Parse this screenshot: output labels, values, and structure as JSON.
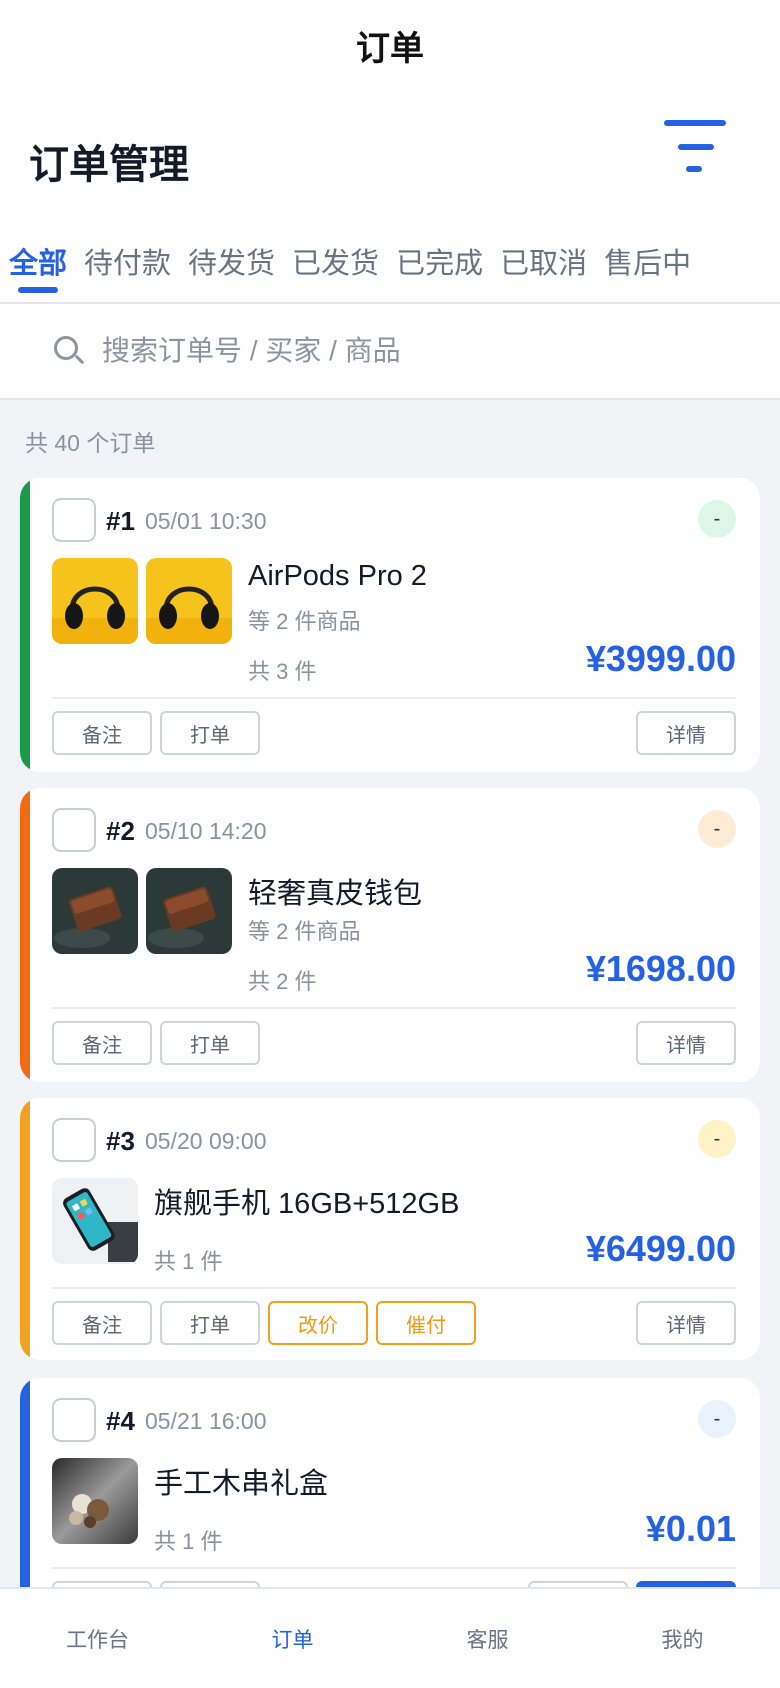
{
  "topbar": {
    "title": "订单"
  },
  "header": {
    "title": "订单管理"
  },
  "tabs": [
    {
      "label": "全部",
      "active": true
    },
    {
      "label": "待付款"
    },
    {
      "label": "待发货"
    },
    {
      "label": "已发货"
    },
    {
      "label": "已完成"
    },
    {
      "label": "已取消"
    },
    {
      "label": "售后中"
    }
  ],
  "search": {
    "placeholder": "搜索订单号 / 买家 / 商品"
  },
  "summary": {
    "count_text": "共 40 个订单"
  },
  "orders": [
    {
      "no": "#1",
      "time": "05/01 10:30",
      "status": "-",
      "status_color": "#dcf7e6",
      "stripe_color": "#1a9b4a",
      "product": "AirPods Pro 2",
      "more": "等 2 件商品",
      "qty": "共 3 件",
      "price": "¥3999.00",
      "buttons": {
        "note": "备注",
        "print": "打单",
        "detail": "详情"
      }
    },
    {
      "no": "#2",
      "time": "05/10 14:20",
      "status": "-",
      "status_color": "#fdebd6",
      "stripe_color": "#f26b12",
      "product": "轻奢真皮钱包",
      "more": "等 2 件商品",
      "qty": "共 2 件",
      "price": "¥1698.00",
      "buttons": {
        "note": "备注",
        "print": "打单",
        "detail": "详情"
      }
    },
    {
      "no": "#3",
      "time": "05/20 09:00",
      "status": "-",
      "status_color": "#fdf3c7",
      "stripe_color": "#f0a21f",
      "product": "旗舰手机 16GB+512GB",
      "qty": "共 1 件",
      "price": "¥6499.00",
      "buttons": {
        "note": "备注",
        "print": "打单",
        "reprice": "改价",
        "remind": "催付",
        "detail": "详情"
      }
    },
    {
      "no": "#4",
      "time": "05/21 16:00",
      "status": "-",
      "status_color": "#e9f1fd",
      "stripe_color": "#2461e3",
      "product": "手工木串礼盒",
      "qty": "共 1 件",
      "price": "¥0.01"
    }
  ],
  "bottom_nav": [
    {
      "label": "工作台"
    },
    {
      "label": "订单",
      "active": true
    },
    {
      "label": "客服"
    },
    {
      "label": "我的"
    }
  ],
  "colors": {
    "accent": "#2461e3",
    "warn": "#f0a21f"
  },
  "icons": [
    "filter-icon",
    "search-icon",
    "headphones-thumbnail",
    "wallet-thumbnail",
    "phone-thumbnail",
    "wooden-beads-thumbnail"
  ]
}
